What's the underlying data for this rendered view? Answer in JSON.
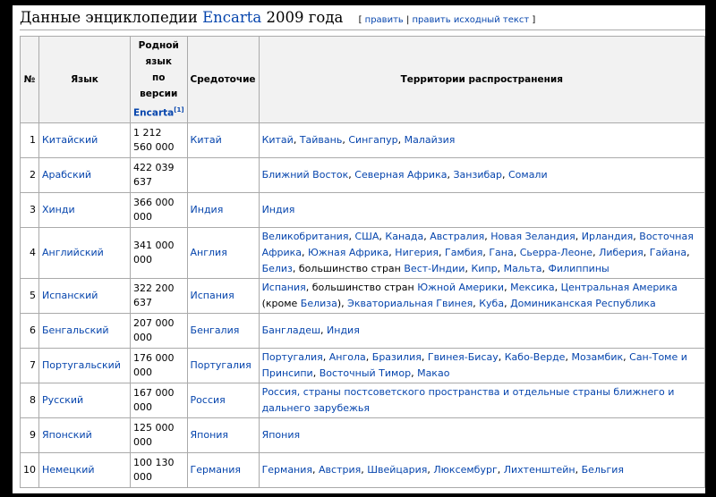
{
  "heading": {
    "title_prefix": "Данные энциклопедии",
    "title_link": "Encarta",
    "title_suffix": "2009 года",
    "edit_links": [
      "править",
      "править исходный текст"
    ]
  },
  "table": {
    "headers": {
      "num": "№",
      "lang": "Язык",
      "speakers_line1": "Родной",
      "speakers_line2": "язык",
      "speakers_line3": "по",
      "speakers_line4": "версии",
      "speakers_link": "Encarta",
      "speakers_sup": "[1]",
      "center": "Средоточие",
      "territories": "Территории распространения"
    },
    "rows": [
      {
        "num": "1",
        "lang": "Китайский",
        "speakers_1": "1 212",
        "speakers_2": "560 000",
        "center": "Китай",
        "terr": [
          {
            "t": "Китай",
            "l": true
          },
          {
            "t": ", ",
            "l": false
          },
          {
            "t": "Тайвань",
            "l": true
          },
          {
            "t": ", ",
            "l": false
          },
          {
            "t": "Сингапур",
            "l": true
          },
          {
            "t": ", ",
            "l": false
          },
          {
            "t": "Малайзия",
            "l": true
          }
        ]
      },
      {
        "num": "2",
        "lang": "Арабский",
        "speakers_1": "422 039",
        "speakers_2": "637",
        "center": "",
        "terr": [
          {
            "t": "Ближний Восток",
            "l": true
          },
          {
            "t": ", ",
            "l": false
          },
          {
            "t": "Северная Африка",
            "l": true
          },
          {
            "t": ", ",
            "l": false
          },
          {
            "t": "Занзибар",
            "l": true
          },
          {
            "t": ", ",
            "l": false
          },
          {
            "t": "Сомали",
            "l": true
          }
        ]
      },
      {
        "num": "3",
        "lang": "Хинди",
        "speakers_1": "366 000",
        "speakers_2": "000",
        "center": "Индия",
        "terr": [
          {
            "t": "Индия",
            "l": true
          }
        ]
      },
      {
        "num": "4",
        "lang": "Английский",
        "speakers_1": "341 000",
        "speakers_2": "000",
        "center": "Англия",
        "terr": [
          {
            "t": "Великобритания",
            "l": true
          },
          {
            "t": ", ",
            "l": false
          },
          {
            "t": "США",
            "l": true
          },
          {
            "t": ", ",
            "l": false
          },
          {
            "t": "Канада",
            "l": true
          },
          {
            "t": ", ",
            "l": false
          },
          {
            "t": "Австралия",
            "l": true
          },
          {
            "t": ", ",
            "l": false
          },
          {
            "t": "Новая Зеландия",
            "l": true
          },
          {
            "t": ", ",
            "l": false
          },
          {
            "t": "Ирландия",
            "l": true
          },
          {
            "t": ", ",
            "l": false
          },
          {
            "t": "Восточная Африка",
            "l": true
          },
          {
            "t": ", ",
            "l": false
          },
          {
            "t": "Южная Африка",
            "l": true
          },
          {
            "t": ", ",
            "l": false
          },
          {
            "t": "Нигерия",
            "l": true
          },
          {
            "t": ", ",
            "l": false
          },
          {
            "t": "Гамбия",
            "l": true
          },
          {
            "t": ", ",
            "l": false
          },
          {
            "t": "Гана",
            "l": true
          },
          {
            "t": ", ",
            "l": false
          },
          {
            "t": "Сьерра-Леоне",
            "l": true
          },
          {
            "t": ", ",
            "l": false
          },
          {
            "t": "Либерия",
            "l": true
          },
          {
            "t": ", ",
            "l": false
          },
          {
            "t": "Гайана",
            "l": true
          },
          {
            "t": ", ",
            "l": false
          },
          {
            "t": "Белиз",
            "l": true
          },
          {
            "t": ", большинство стран ",
            "l": false
          },
          {
            "t": "Вест-Индии",
            "l": true
          },
          {
            "t": ", ",
            "l": false
          },
          {
            "t": "Кипр",
            "l": true
          },
          {
            "t": ", ",
            "l": false
          },
          {
            "t": "Мальта",
            "l": true
          },
          {
            "t": ", ",
            "l": false
          },
          {
            "t": "Филиппины",
            "l": true
          }
        ]
      },
      {
        "num": "5",
        "lang": "Испанский",
        "speakers_1": "322 200",
        "speakers_2": "637",
        "center": "Испания",
        "terr": [
          {
            "t": "Испания",
            "l": true
          },
          {
            "t": ", большинство стран ",
            "l": false
          },
          {
            "t": "Южной Америки",
            "l": true
          },
          {
            "t": ", ",
            "l": false
          },
          {
            "t": "Мексика",
            "l": true
          },
          {
            "t": ", ",
            "l": false
          },
          {
            "t": "Центральная Америка",
            "l": true
          },
          {
            "t": " (кроме ",
            "l": false
          },
          {
            "t": "Белиза",
            "l": true
          },
          {
            "t": "), ",
            "l": false
          },
          {
            "t": "Экваториальная Гвинея",
            "l": true
          },
          {
            "t": ", ",
            "l": false
          },
          {
            "t": "Куба",
            "l": true
          },
          {
            "t": ", ",
            "l": false
          },
          {
            "t": "Доминиканская Республика",
            "l": true
          }
        ]
      },
      {
        "num": "6",
        "lang": "Бенгальский",
        "speakers_1": "207 000",
        "speakers_2": "000",
        "center": "Бенгалия",
        "terr": [
          {
            "t": "Бангладеш",
            "l": true
          },
          {
            "t": ", ",
            "l": false
          },
          {
            "t": "Индия",
            "l": true
          }
        ]
      },
      {
        "num": "7",
        "lang": "Португальский",
        "speakers_1": "176 000",
        "speakers_2": "000",
        "center": "Португалия",
        "terr": [
          {
            "t": "Португалия",
            "l": true
          },
          {
            "t": ", ",
            "l": false
          },
          {
            "t": "Ангола",
            "l": true
          },
          {
            "t": ", ",
            "l": false
          },
          {
            "t": "Бразилия",
            "l": true
          },
          {
            "t": ", ",
            "l": false
          },
          {
            "t": "Гвинея-Бисау",
            "l": true
          },
          {
            "t": ", ",
            "l": false
          },
          {
            "t": "Кабо-Верде",
            "l": true
          },
          {
            "t": ", ",
            "l": false
          },
          {
            "t": "Мозамбик",
            "l": true
          },
          {
            "t": ", ",
            "l": false
          },
          {
            "t": "Сан-Томе и Принсипи",
            "l": true
          },
          {
            "t": ", ",
            "l": false
          },
          {
            "t": "Восточный Тимор",
            "l": true
          },
          {
            "t": ", ",
            "l": false
          },
          {
            "t": "Макао",
            "l": true
          }
        ]
      },
      {
        "num": "8",
        "lang": "Русский",
        "speakers_1": "167 000",
        "speakers_2": "000",
        "center": "Россия",
        "terr": [
          {
            "t": "Россия",
            "l": true
          },
          {
            "t": ", страны постсоветского пространства и отдельные страны ближнего и дальнего зарубежья",
            "l": true
          }
        ]
      },
      {
        "num": "9",
        "lang": "Японский",
        "speakers_1": "125 000",
        "speakers_2": "000",
        "center": "Япония",
        "terr": [
          {
            "t": "Япония",
            "l": true
          }
        ]
      },
      {
        "num": "10",
        "lang": "Немецкий",
        "speakers_1": "100 130",
        "speakers_2": "000",
        "center": "Германия",
        "terr": [
          {
            "t": "Германия",
            "l": true
          },
          {
            "t": ", ",
            "l": false
          },
          {
            "t": "Австрия",
            "l": true
          },
          {
            "t": ", ",
            "l": false
          },
          {
            "t": "Швейцария",
            "l": true
          },
          {
            "t": ", ",
            "l": false
          },
          {
            "t": "Люксембург",
            "l": true
          },
          {
            "t": ", ",
            "l": false
          },
          {
            "t": "Лихтенштейн",
            "l": true
          },
          {
            "t": ", ",
            "l": false
          },
          {
            "t": "Бельгия",
            "l": true
          }
        ]
      }
    ]
  },
  "colors": {
    "link": "#0645ad",
    "header_bg": "#f2f2f2",
    "border": "#aaaaaa",
    "frame": "#000000"
  }
}
